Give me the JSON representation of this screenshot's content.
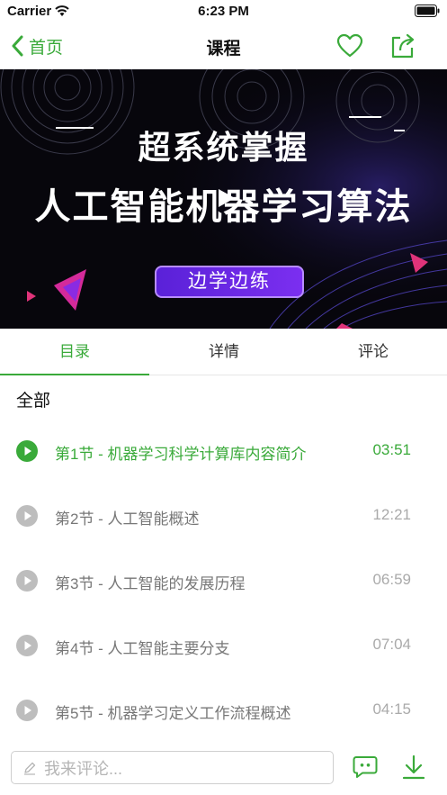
{
  "status_bar": {
    "carrier": "Carrier",
    "time": "6:23 PM"
  },
  "nav": {
    "back_label": "首页",
    "title": "课程"
  },
  "banner": {
    "line1": "超系统掌握",
    "line2": "人工智能机器学习算法",
    "tag": "边学边练"
  },
  "tabs": [
    {
      "label": "目录",
      "active": true
    },
    {
      "label": "详情",
      "active": false
    },
    {
      "label": "评论",
      "active": false
    }
  ],
  "section_title": "全部",
  "lessons": [
    {
      "title": "第1节 - 机器学习科学计算库内容简介",
      "duration": "03:51",
      "active": true
    },
    {
      "title": "第2节 - 人工智能概述",
      "duration": "12:21",
      "active": false
    },
    {
      "title": "第3节 - 人工智能的发展历程",
      "duration": "06:59",
      "active": false
    },
    {
      "title": "第4节 - 人工智能主要分支",
      "duration": "07:04",
      "active": false
    },
    {
      "title": "第5节 - 机器学习定义工作流程概述",
      "duration": "04:15",
      "active": false
    }
  ],
  "comment_bar": {
    "placeholder": "我来评论..."
  },
  "colors": {
    "accent": "#3aaa3a",
    "inactive_icon": "#bdbdbd",
    "banner_tag": "#6a28e6"
  },
  "icons": [
    "wifi-icon",
    "battery-icon",
    "back-chevron-icon",
    "heart-icon",
    "share-icon",
    "play-icon",
    "pencil-icon",
    "comment-bubble-icon",
    "download-icon"
  ]
}
